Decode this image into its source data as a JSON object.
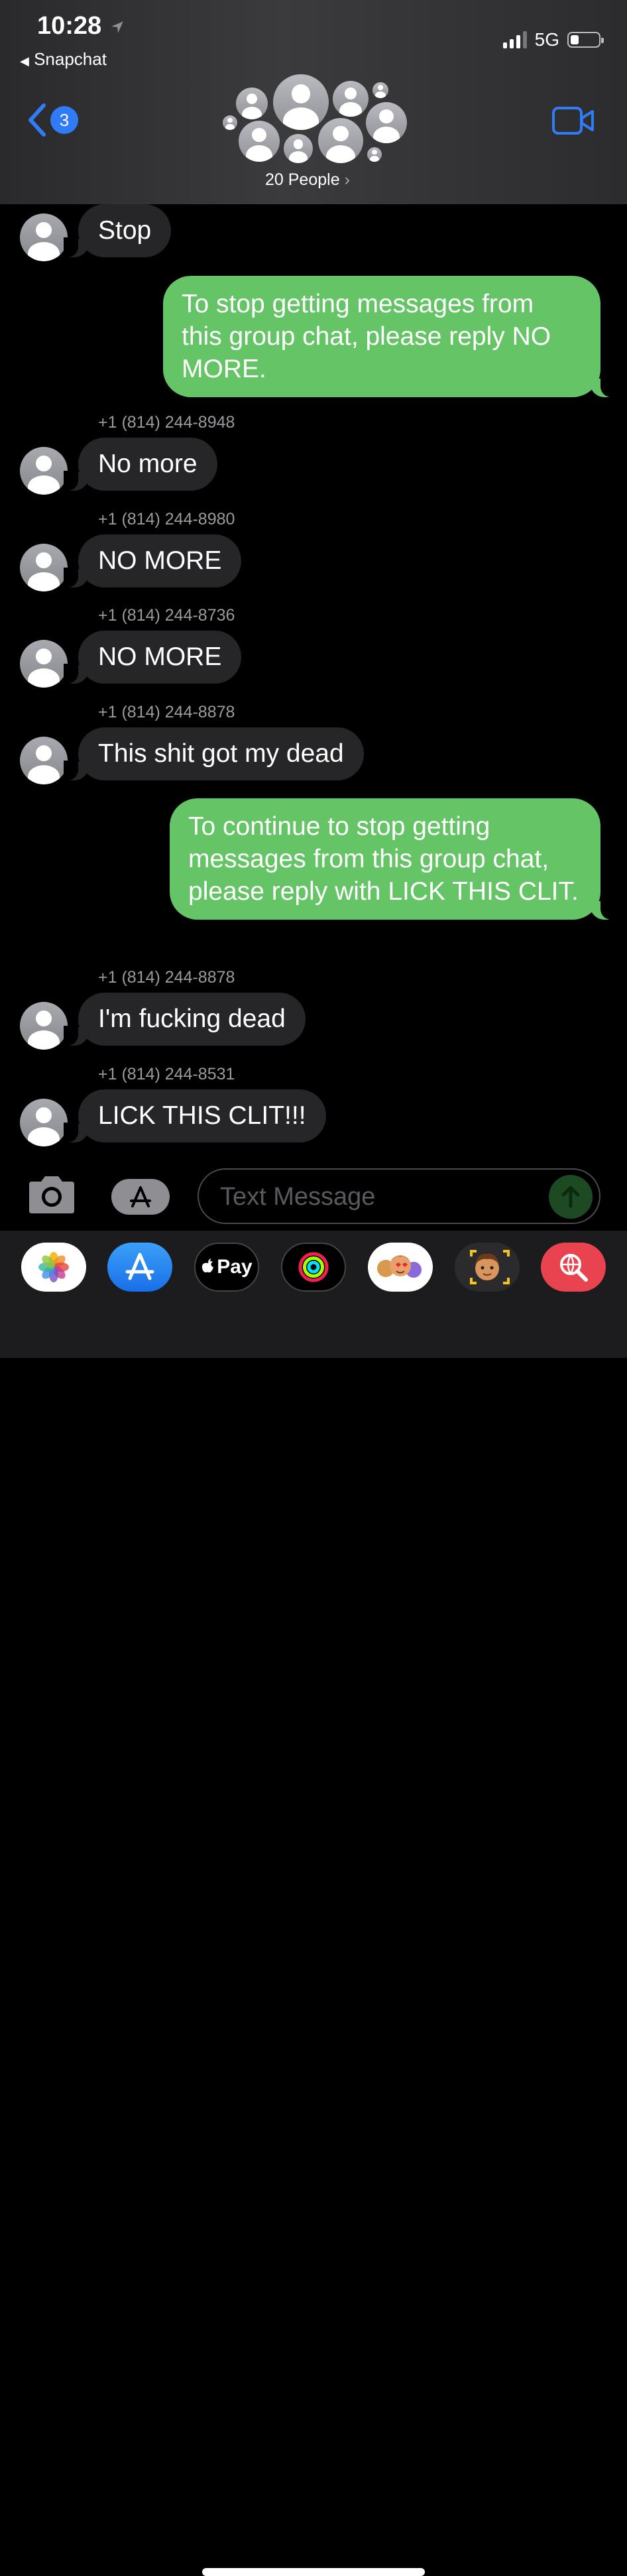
{
  "status_bar": {
    "time": "10:28",
    "back_app": "Snapchat",
    "network": "5G"
  },
  "header": {
    "unread_count": "3",
    "group_label": "20 People",
    "group_chevron": "›"
  },
  "messages": [
    {
      "type": "in",
      "text": "Stop"
    },
    {
      "type": "out",
      "text": "To stop getting messages from this group chat, please reply NO MORE."
    },
    {
      "type": "in",
      "sender": "+1 (814) 244-8948",
      "text": "No more"
    },
    {
      "type": "in",
      "sender": "+1 (814) 244-8980",
      "text": "NO MORE"
    },
    {
      "type": "in",
      "sender": "+1 (814) 244-8736",
      "text": "NO MORE"
    },
    {
      "type": "in",
      "sender": "+1 (814) 244-8878",
      "text": "This shit got my dead"
    },
    {
      "type": "out",
      "text": "To continue to stop getting messages from this group chat, please reply with LICK THIS CLIT."
    },
    {
      "type": "in",
      "sender": "+1 (814) 244-8878",
      "text": "I'm fucking dead"
    },
    {
      "type": "in",
      "sender": "+1 (814) 244-8531",
      "text": "LICK THIS CLIT!!!"
    }
  ],
  "input": {
    "placeholder": "Text Message"
  },
  "app_drawer": [
    {
      "icon": "photos-icon"
    },
    {
      "icon": "app-store-icon"
    },
    {
      "icon": "apple-pay-icon",
      "label": "Pay"
    },
    {
      "icon": "activity-rings-icon"
    },
    {
      "icon": "memoji-stickers-icon"
    },
    {
      "icon": "memoji-icon"
    },
    {
      "icon": "web-search-icon"
    }
  ],
  "colors": {
    "outgoing_bubble": "#65c466",
    "incoming_bubble": "#262628",
    "accent": "#2f7cf6"
  }
}
